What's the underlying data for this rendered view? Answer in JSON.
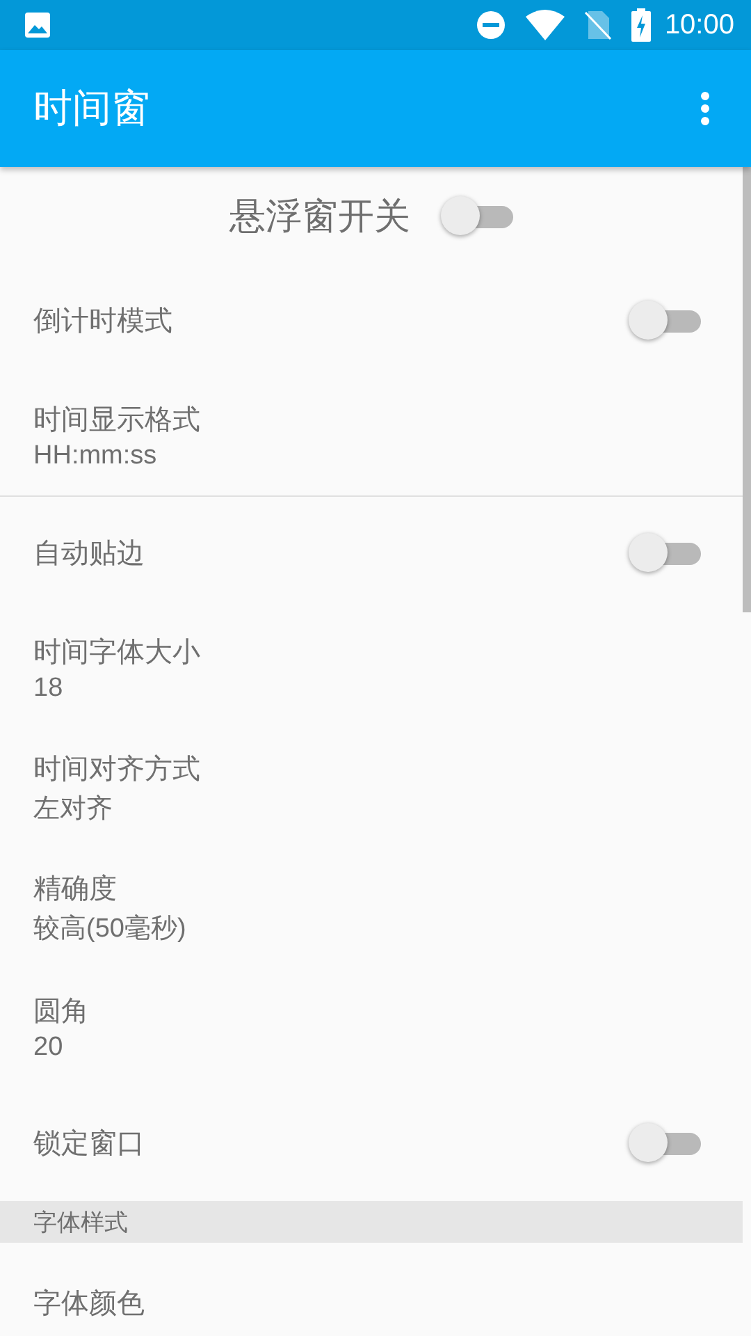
{
  "status_bar": {
    "time": "10:00"
  },
  "app_bar": {
    "title": "时间窗"
  },
  "master_switch": {
    "label": "悬浮窗开关",
    "on": false
  },
  "items": [
    {
      "kind": "switch",
      "title": "倒计时模式",
      "on": false
    },
    {
      "kind": "value",
      "title": "时间显示格式",
      "summary": "HH:mm:ss",
      "divider": true
    },
    {
      "kind": "switch",
      "title": "自动贴边",
      "on": false
    },
    {
      "kind": "value",
      "title": "时间字体大小",
      "summary": "18"
    },
    {
      "kind": "value",
      "title": "时间对齐方式",
      "summary": "左对齐"
    },
    {
      "kind": "value",
      "title": "精确度",
      "summary": "较高(50毫秒)"
    },
    {
      "kind": "value",
      "title": "圆角",
      "summary": "20"
    },
    {
      "kind": "switch",
      "title": "锁定窗口",
      "on": false
    },
    {
      "kind": "header",
      "title": "字体样式"
    },
    {
      "kind": "value",
      "title": "字体颜色"
    }
  ]
}
